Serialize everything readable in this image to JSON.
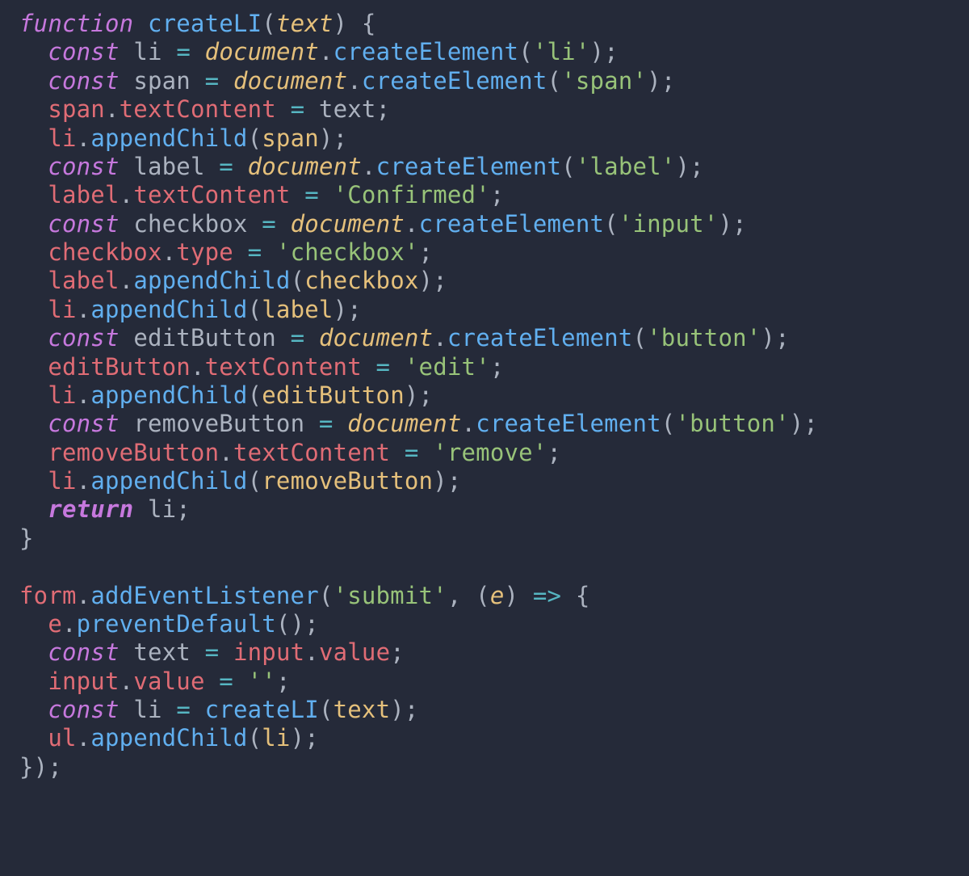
{
  "code": {
    "line1": {
      "kw_function": "function",
      "fn_name": "createLI",
      "param": "text"
    },
    "line2": {
      "kw_const": "const",
      "var": "li",
      "obj": "document",
      "method": "createElement",
      "arg": "'li'"
    },
    "line3": {
      "kw_const": "const",
      "var": "span",
      "obj": "document",
      "method": "createElement",
      "arg": "'span'"
    },
    "line4": {
      "obj": "span",
      "prop": "textContent",
      "val": "text"
    },
    "line5": {
      "obj": "li",
      "method": "appendChild",
      "arg": "span"
    },
    "line6": {
      "kw_const": "const",
      "var": "label",
      "obj": "document",
      "method": "createElement",
      "arg": "'label'"
    },
    "line7": {
      "obj": "label",
      "prop": "textContent",
      "val": "'Confirmed'"
    },
    "line8": {
      "kw_const": "const",
      "var": "checkbox",
      "obj": "document",
      "method": "createElement",
      "arg": "'input'"
    },
    "line9": {
      "obj": "checkbox",
      "prop": "type",
      "val": "'checkbox'"
    },
    "line10": {
      "obj": "label",
      "method": "appendChild",
      "arg": "checkbox"
    },
    "line11": {
      "obj": "li",
      "method": "appendChild",
      "arg": "label"
    },
    "line12": {
      "kw_const": "const",
      "var": "editButton",
      "obj": "document",
      "method": "createElement",
      "arg": "'button'"
    },
    "line13": {
      "obj": "editButton",
      "prop": "textContent",
      "val": "'edit'"
    },
    "line14": {
      "obj": "li",
      "method": "appendChild",
      "arg": "editButton"
    },
    "line15": {
      "kw_const": "const",
      "var": "removeButton",
      "obj": "document",
      "method": "createElement",
      "arg": "'button'"
    },
    "line16": {
      "obj": "removeButton",
      "prop": "textContent",
      "val": "'remove'"
    },
    "line17": {
      "obj": "li",
      "method": "appendChild",
      "arg": "removeButton"
    },
    "line18": {
      "kw_return": "return",
      "val": "li"
    },
    "line21": {
      "obj": "form",
      "method": "addEventListener",
      "arg1": "'submit'",
      "param": "e"
    },
    "line22": {
      "obj": "e",
      "method": "preventDefault"
    },
    "line23": {
      "kw_const": "const",
      "var": "text",
      "obj": "input",
      "prop": "value"
    },
    "line24": {
      "obj": "input",
      "prop": "value",
      "val": "''"
    },
    "line25": {
      "kw_const": "const",
      "var": "li",
      "fn": "createLI",
      "arg": "text"
    },
    "line26": {
      "obj": "ul",
      "method": "appendChild",
      "arg": "li"
    }
  }
}
